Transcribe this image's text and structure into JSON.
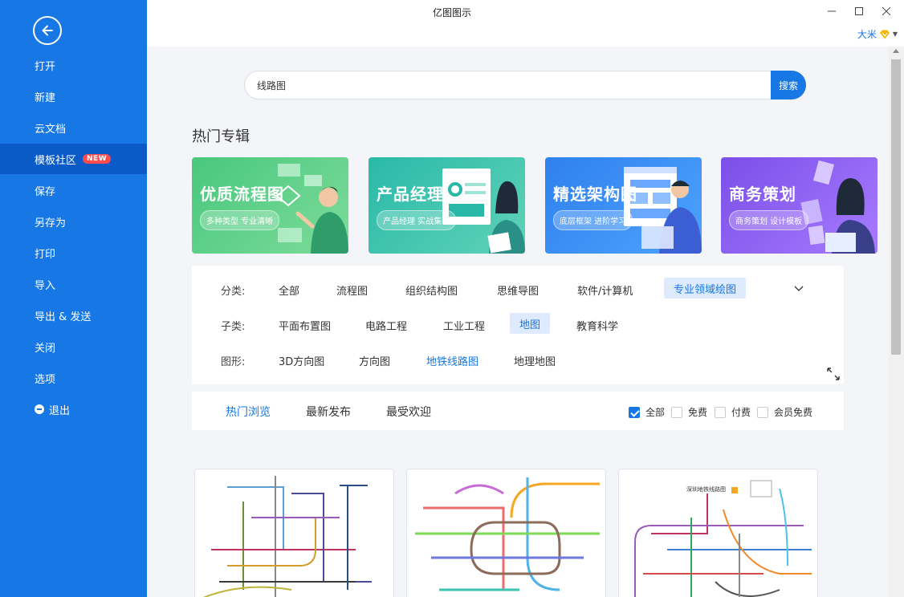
{
  "window": {
    "title": "亿图图示",
    "user_name": "大米"
  },
  "sidebar": {
    "items": [
      {
        "label": "打开"
      },
      {
        "label": "新建"
      },
      {
        "label": "云文档"
      },
      {
        "label": "模板社区",
        "badge": "NEW"
      },
      {
        "label": "保存"
      },
      {
        "label": "另存为"
      },
      {
        "label": "打印"
      },
      {
        "label": "导入"
      },
      {
        "label": "导出 & 发送"
      },
      {
        "label": "关闭"
      },
      {
        "label": "选项"
      },
      {
        "label": "退出"
      }
    ]
  },
  "search": {
    "value": "线路图",
    "button_label": "搜索"
  },
  "hot_section": {
    "title": "热门专辑",
    "banners": [
      {
        "title": "优质流程图",
        "subtitle": "多种类型 专业清晰",
        "color": "#3dbf74"
      },
      {
        "title": "产品经理",
        "subtitle": "产品经理 实战集合",
        "color": "#2ab9a8"
      },
      {
        "title": "精选架构图",
        "subtitle": "底层框架 进阶学习",
        "color": "#2f80ed"
      },
      {
        "title": "商务策划",
        "subtitle": "商务策划 设计模板",
        "color": "#8b5cf6"
      }
    ]
  },
  "filters": {
    "category": {
      "label": "分类:",
      "options": [
        "全部",
        "流程图",
        "组织结构图",
        "思维导图",
        "软件/计算机",
        "专业领域绘图"
      ],
      "selected": "专业领域绘图"
    },
    "subcategory": {
      "label": "子类:",
      "options": [
        "平面布置图",
        "电路工程",
        "工业工程",
        "地图",
        "教育科学"
      ],
      "selected": "地图"
    },
    "shape": {
      "label": "图形:",
      "options": [
        "3D方向图",
        "方向图",
        "地铁线路图",
        "地理地图"
      ],
      "selected": "地铁线路图"
    }
  },
  "sort": {
    "tabs": [
      "热门浏览",
      "最新发布",
      "最受欢迎"
    ],
    "active": "热门浏览",
    "price_filters": [
      {
        "label": "全部",
        "checked": true
      },
      {
        "label": "免费",
        "checked": false
      },
      {
        "label": "付费",
        "checked": false
      },
      {
        "label": "会员免费",
        "checked": false
      }
    ]
  },
  "templates": [
    {
      "icon": "subway-map-thumbnail"
    },
    {
      "icon": "subway-map-thumbnail"
    },
    {
      "icon": "subway-map-thumbnail",
      "caption": "深圳地铁线路图"
    }
  ],
  "colors": {
    "accent": "#1677e5",
    "sidebar": "#1677e5",
    "sidebar_active": "#0a5bc7",
    "badge": "#ff4d4f"
  }
}
